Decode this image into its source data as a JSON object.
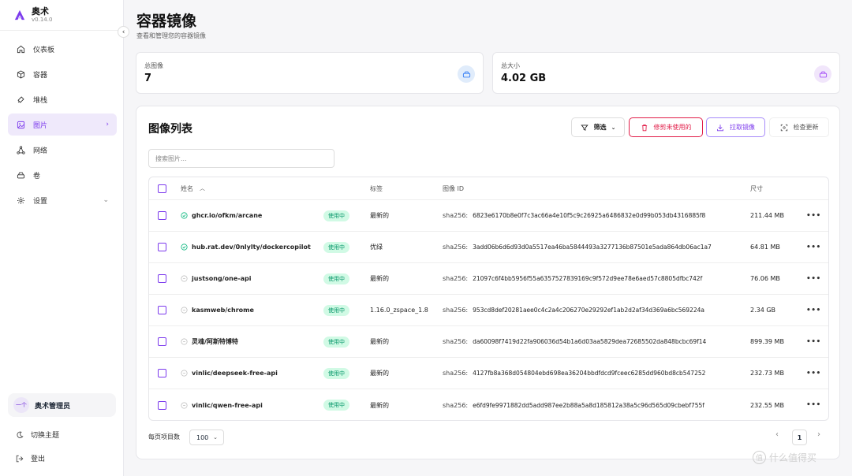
{
  "app": {
    "name": "奥术",
    "version": "v0.14.0"
  },
  "nav": [
    {
      "label": "仪表板",
      "icon": "home-icon"
    },
    {
      "label": "容器",
      "icon": "box-icon"
    },
    {
      "label": "堆栈",
      "icon": "layers-icon"
    },
    {
      "label": "图片",
      "icon": "image-icon",
      "active": true
    },
    {
      "label": "网络",
      "icon": "network-icon"
    },
    {
      "label": "卷",
      "icon": "drive-icon"
    },
    {
      "label": "设置",
      "icon": "gear-icon"
    }
  ],
  "user": {
    "avatar_text": "一个",
    "name": "奥术管理员"
  },
  "sidebar_bottom": {
    "theme": "切换主题",
    "logout": "登出"
  },
  "header": {
    "title": "容器镜像",
    "subtitle": "查看和管理您的容器镜像"
  },
  "stats": {
    "total_images": {
      "label": "总图像",
      "value": "7"
    },
    "total_size": {
      "label": "总大小",
      "value": "4.02 GB"
    }
  },
  "panel": {
    "title": "图像列表",
    "filter_label": "筛选",
    "prune_label": "修剪未使用的",
    "pull_label": "拉取镜像",
    "check_label": "检查更新",
    "search_placeholder": "搜索图片..."
  },
  "table": {
    "columns": {
      "name": "姓名",
      "tag": "标签",
      "id": "图像 ID",
      "size": "尺寸"
    },
    "id_prefix": "sha256:",
    "rows": [
      {
        "repo": "ghcr.io/ofkm/arcane",
        "status": "使用中",
        "tag": "最新的",
        "id": "6823e6170b8e0f7c3ac66a4e10f5c9c26925a6486832e0d99b053db4316885f8",
        "size": "211.44 MB",
        "verified": true
      },
      {
        "repo": "hub.rat.dev/0nlylty/dockercopilot",
        "status": "使用中",
        "tag": "优绿",
        "id": "3add06b6d6d93d0a5517ea46ba5844493a3277136b87501e5ada864db06ac1a7",
        "size": "64.81 MB",
        "verified": true
      },
      {
        "repo": "justsong/one-api",
        "status": "使用中",
        "tag": "最新的",
        "id": "21097c6f4bb5956f55a6357527839169c9f572d9ee78e6aed57c8805dfbc742f",
        "size": "76.06 MB",
        "verified": false
      },
      {
        "repo": "kasmweb/chrome",
        "status": "使用中",
        "tag": "1.16.0_zspace_1.8",
        "id": "953cd8def20281aee0c4c2a4c206270e29292ef1ab2d2af34d369a6bc569224a",
        "size": "2.34 GB",
        "verified": false
      },
      {
        "repo": "灵魂/阿斯特博特",
        "status": "使用中",
        "tag": "最新的",
        "id": "da60098f7419d22fa906036d54b1a6d03aa5829dea72685502da848bcbc69f14",
        "size": "899.39 MB",
        "verified": false
      },
      {
        "repo": "vinlic/deepseek-free-api",
        "status": "使用中",
        "tag": "最新的",
        "id": "4127fb8a368d054804ebd698ea36204bbdfdcd9fceec6285dd960bd8cb547252",
        "size": "232.73 MB",
        "verified": false
      },
      {
        "repo": "vinlic/qwen-free-api",
        "status": "使用中",
        "tag": "最新的",
        "id": "e6fd9fe9971882dd5add987ee2b88a5a8d185812a38a5c96d565d09cbebf755f",
        "size": "232.55 MB",
        "verified": false
      }
    ]
  },
  "pagination": {
    "per_page_label": "每页项目数",
    "per_page_value": "100",
    "current_page": "1"
  },
  "watermark": {
    "text": "什么值得买",
    "symbol": "值"
  },
  "colors": {
    "accent": "#7c3aed",
    "danger": "#e11d48",
    "success": "#059669"
  }
}
